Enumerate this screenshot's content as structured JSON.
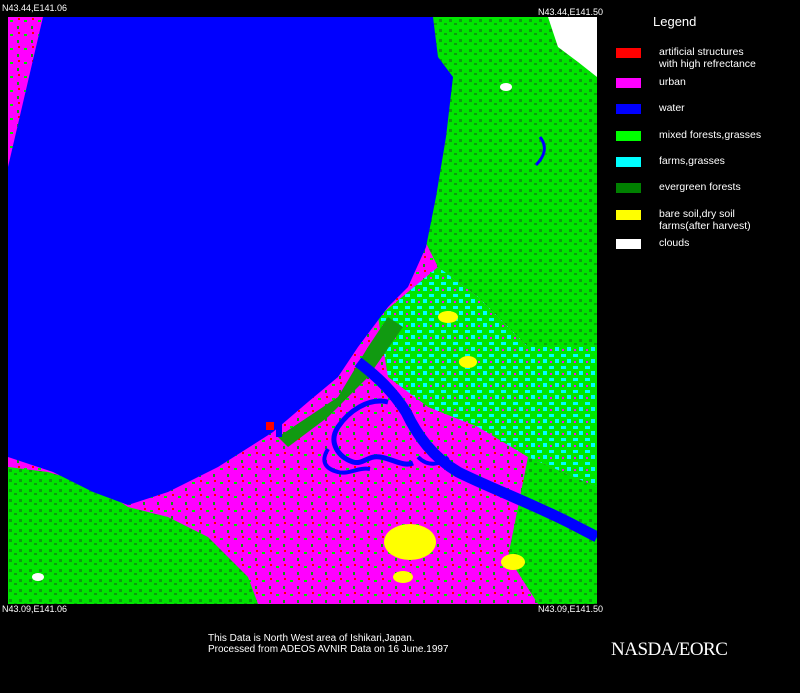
{
  "corners": {
    "top_left": "N43.44,E141.06",
    "top_right": "N43.44,E141.50",
    "bottom_left": "N43.09,E141.06",
    "bottom_right": "N43.09,E141.50"
  },
  "legend": {
    "title": "Legend",
    "items": [
      {
        "label": "artificial structures\nwith high refrectance",
        "color": "#ff0000"
      },
      {
        "label": "urban",
        "color": "#ff00ff"
      },
      {
        "label": "water",
        "color": "#0000ff"
      },
      {
        "label": "mixed forests,grasses",
        "color": "#00ff00"
      },
      {
        "label": "farms,grasses",
        "color": "#00ffff"
      },
      {
        "label": "evergreen forests",
        "color": "#008000"
      },
      {
        "label": "bare soil,dry soil\nfarms(after harvest)",
        "color": "#ffff00"
      },
      {
        "label": "clouds",
        "color": "#ffffff"
      }
    ]
  },
  "caption": {
    "line1": "This Data is North West area of Ishikari,Japan.",
    "line2": "Processed from ADEOS AVNIR Data on 16 June.1997"
  },
  "credit": "NASDA/EORC",
  "map_colors": {
    "water": "#0000ff",
    "urban": "#ff00ff",
    "mixed_forest": "#00e600",
    "evergreen": "#119a11",
    "farms": "#00ffff",
    "bare_soil": "#ffff00",
    "artificial": "#ff0000",
    "clouds": "#ffffff"
  }
}
